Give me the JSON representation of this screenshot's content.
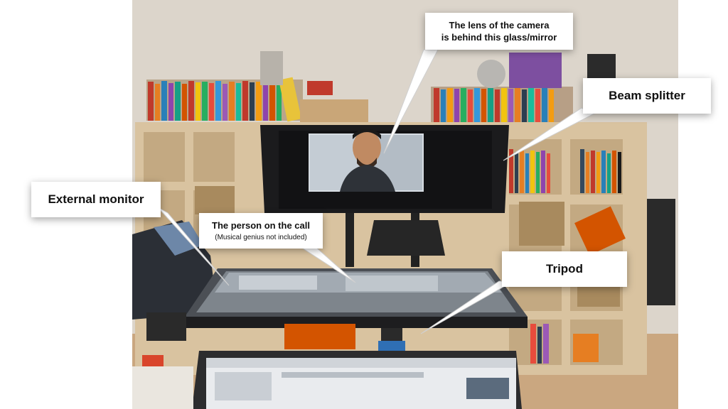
{
  "callouts": {
    "lens": {
      "line1": "The lens of the camera",
      "line2": "is behind this glass/mirror"
    },
    "beam_splitter": {
      "label": "Beam splitter"
    },
    "external_monitor": {
      "label": "External monitor"
    },
    "person": {
      "label": "The person on the call",
      "note": "(Musical genius not included)"
    },
    "tripod": {
      "label": "Tripod"
    }
  },
  "colors": {
    "callout_bg": "#ffffff",
    "callout_text": "#111111",
    "wall": "#dcd5cb",
    "shelf": "#d9c3a0",
    "teleprompter": "#1b1b1d"
  }
}
